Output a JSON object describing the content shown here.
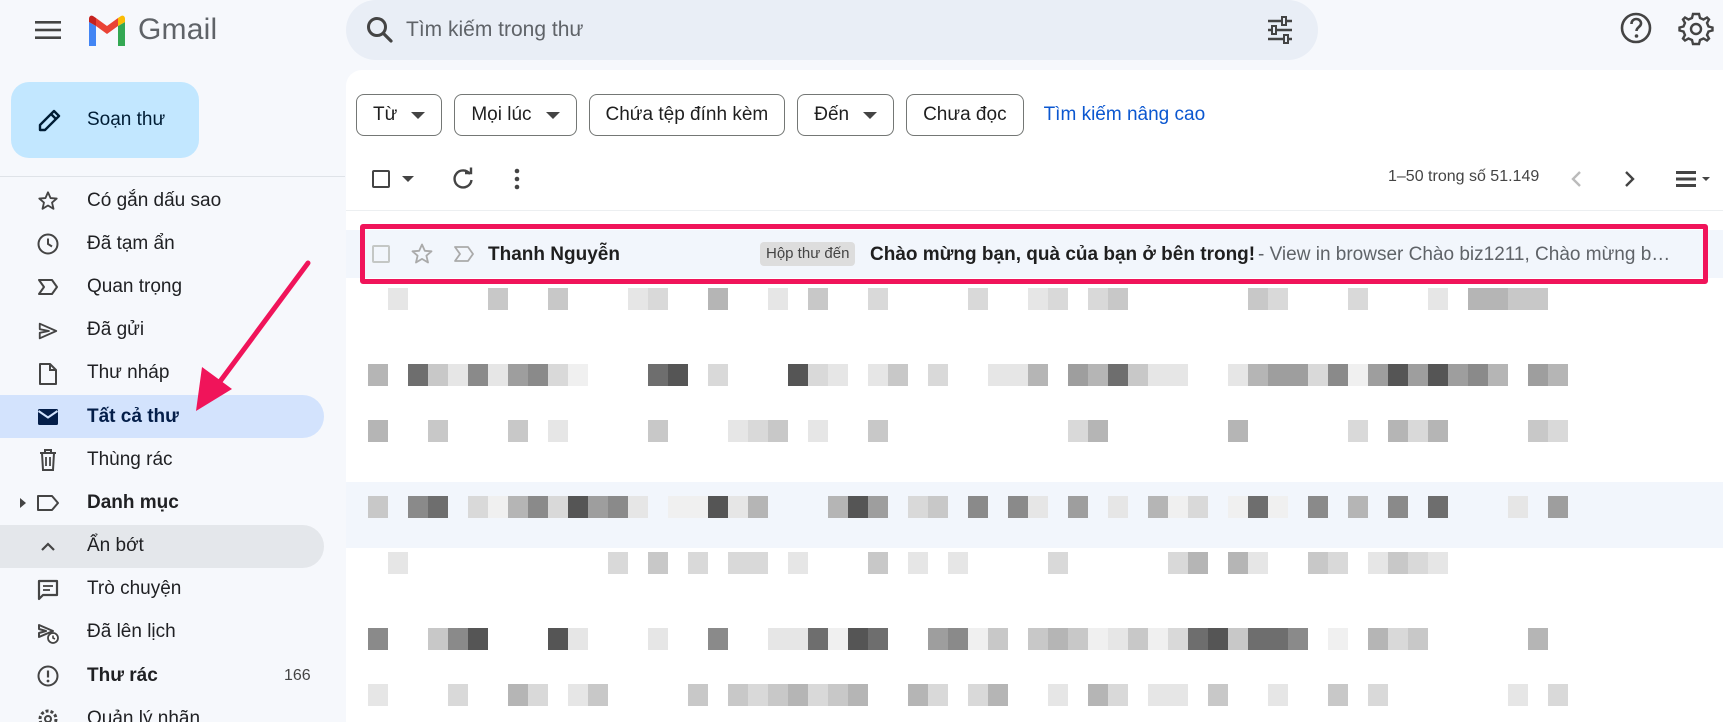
{
  "app": {
    "logo_text": "Gmail",
    "search_placeholder": "Tìm kiếm trong thư"
  },
  "compose": {
    "label": "Soạn thư"
  },
  "sidebar": {
    "items": [
      {
        "label": "Có gắn dấu sao",
        "icon": "star-icon"
      },
      {
        "label": "Đã tạm ẩn",
        "icon": "clock-icon"
      },
      {
        "label": "Quan trọng",
        "icon": "important-icon"
      },
      {
        "label": "Đã gửi",
        "icon": "send-icon"
      },
      {
        "label": "Thư nháp",
        "icon": "draft-icon"
      },
      {
        "label": "Tất cả thư",
        "icon": "all-mail-icon",
        "active": true
      },
      {
        "label": "Thùng rác",
        "icon": "trash-icon"
      },
      {
        "label": "Danh mục",
        "icon": "label-icon"
      },
      {
        "label": "Ẩn bớt",
        "icon": "chevron-up-icon"
      },
      {
        "label": "Trò chuyện",
        "icon": "chat-icon"
      },
      {
        "label": "Đã lên lịch",
        "icon": "scheduled-icon"
      },
      {
        "label": "Thư rác",
        "icon": "spam-icon",
        "count": "166"
      },
      {
        "label": "Quản lý nhãn",
        "icon": "gear-icon"
      }
    ]
  },
  "filters": {
    "from": "Từ",
    "any_time": "Mọi lúc",
    "has_attachment": "Chứa tệp đính kèm",
    "to": "Đến",
    "unread": "Chưa đọc",
    "advanced_search": "Tìm kiếm nâng cao"
  },
  "toolbar": {
    "pager": "1–50 trong số 51.149"
  },
  "email": {
    "sender": "Thanh Nguyễn",
    "label": "Hộp thư đến",
    "subject": "Chào mừng bạn, quà của bạn ở bên trong!",
    "snippet": "- View in browser Chào biz1211, Chào mừng bạ..."
  },
  "colors": {
    "highlight": "#f0145a",
    "compose_bg": "#c2e7ff",
    "active_nav": "#d3e3fd",
    "link": "#0b57d0"
  }
}
